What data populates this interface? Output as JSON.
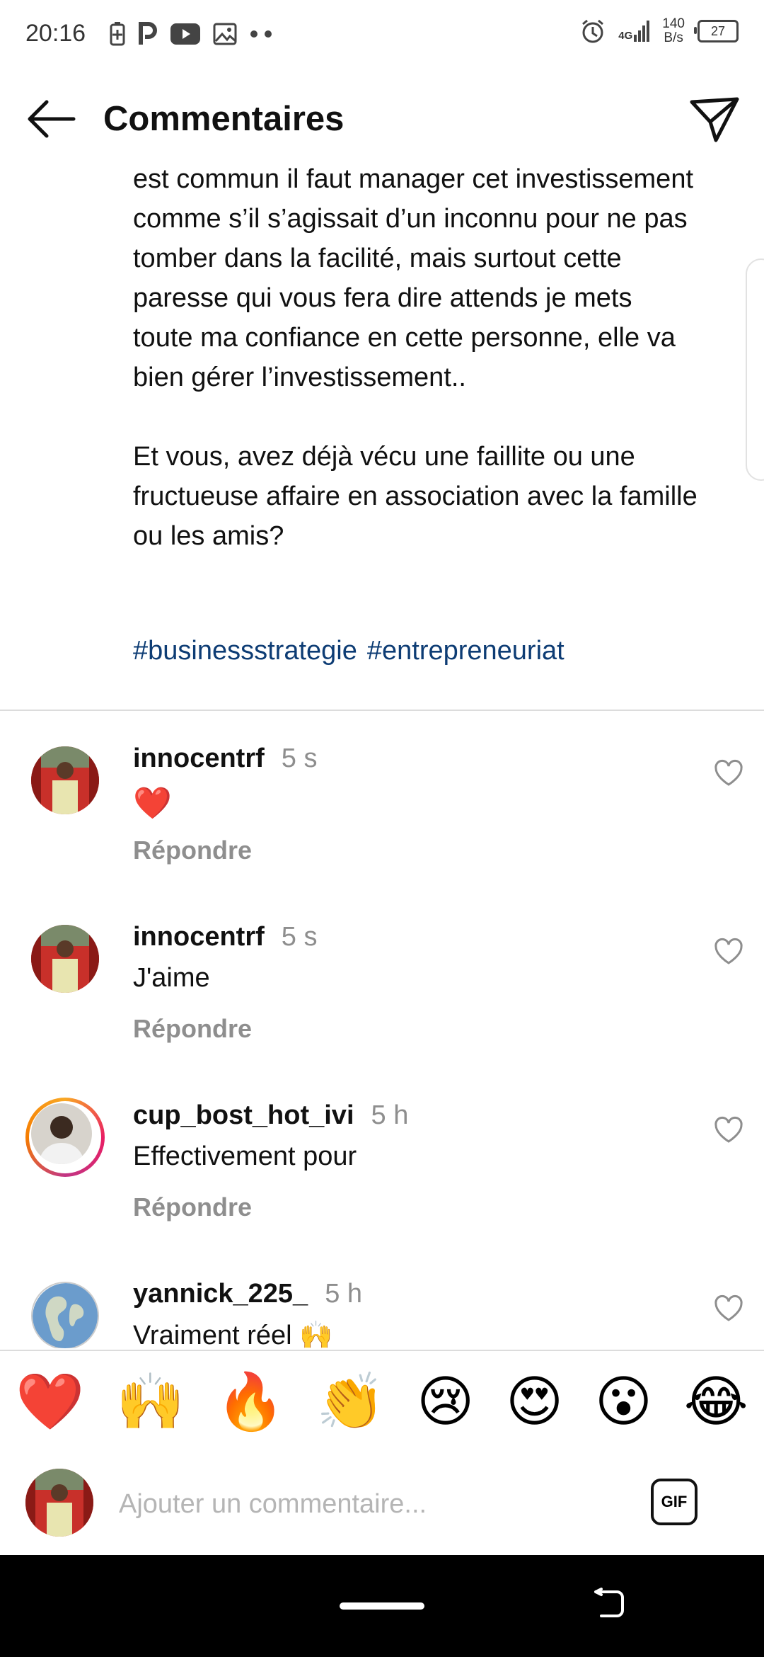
{
  "status_bar": {
    "time": "20:16",
    "network": "4G",
    "speed_value": "140",
    "speed_unit": "B/s",
    "battery": "27"
  },
  "header": {
    "title": "Commentaires"
  },
  "caption": {
    "paragraph1": "est commun il faut manager cet investissement comme s’il s’agissait d’un inconnu pour ne pas tomber dans la facilité, mais surtout cette paresse qui vous fera dire attends je mets toute ma confiance en cette personne, elle va bien gérer l’investissement..",
    "paragraph2": "Et vous, avez déjà vécu une faillite ou une fructueuse affaire en association avec la famille ou les amis?",
    "hashtags": [
      "#businessstrategie",
      "#entrepreneuriat"
    ]
  },
  "comments": [
    {
      "username": "innocentrf",
      "time": "5 s",
      "text": "❤️",
      "reply": "Répondre"
    },
    {
      "username": "innocentrf",
      "time": "5 s",
      "text": "J'aime",
      "reply": "Répondre"
    },
    {
      "username": "cup_bost_hot_ivi",
      "time": "5 h",
      "text": "Effectivement pour",
      "reply": "Répondre"
    },
    {
      "username": "yannick_225_",
      "time": "5 h",
      "text": "Vraiment réel 🙌",
      "reply": ""
    }
  ],
  "emoji_bar": [
    "❤️",
    "🙌",
    "🔥",
    "👏",
    "😢",
    "😍",
    "😮",
    "😂"
  ],
  "input": {
    "placeholder": "Ajouter un commentaire...",
    "gif_label": "GIF"
  },
  "colors": {
    "hashtag": "#0d3c74",
    "secondary_text": "#8e8e8e",
    "like_red": "#ed4956"
  }
}
